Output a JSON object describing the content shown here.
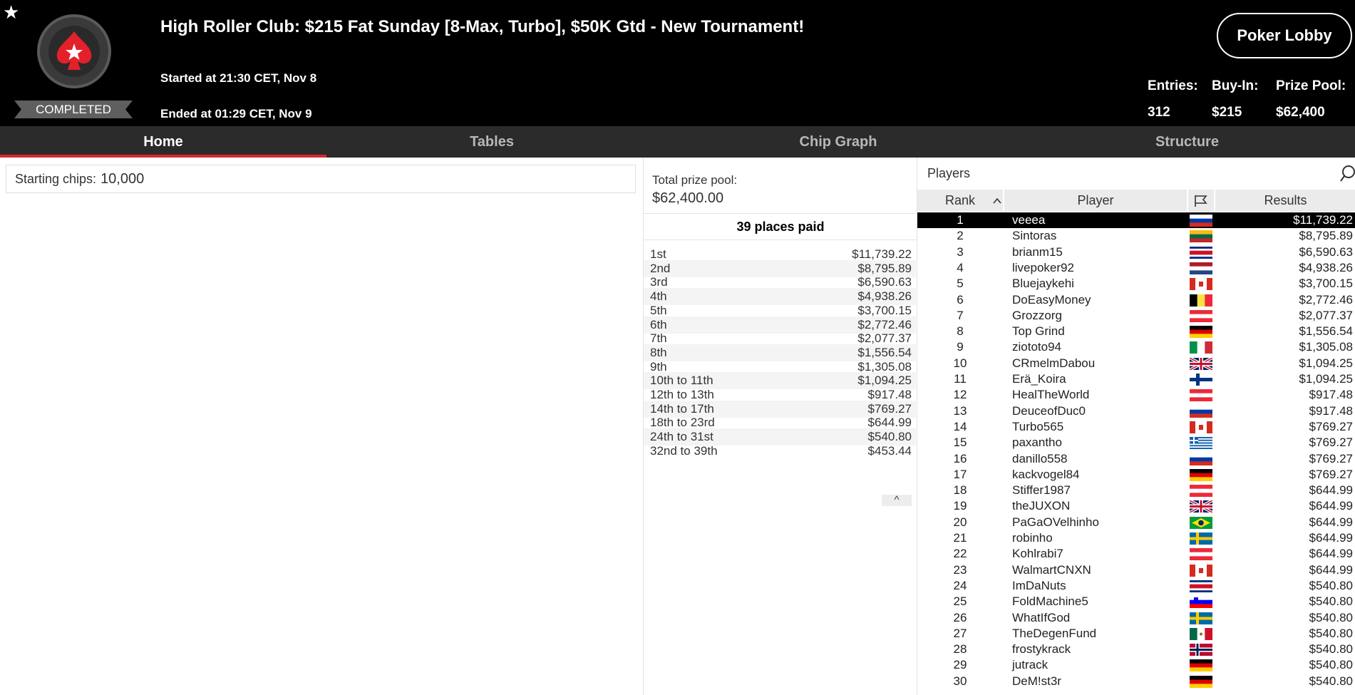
{
  "header": {
    "title": "High Roller Club: $215 Fat Sunday [8-Max, Turbo], $50K Gtd - New Tournament!",
    "started": "Started at 21:30 CET, Nov 8",
    "ended": "Ended at 01:29 CET, Nov 9",
    "status": "COMPLETED",
    "favorite_icon": "star-icon",
    "logo_icon": "spade-star-logo",
    "lobby_button": "Poker Lobby",
    "entries_label": "Entries:",
    "entries_value": "312",
    "buyin_label": "Buy-In:",
    "buyin_value": "$215",
    "prizepool_label": "Prize Pool:",
    "prizepool_value": "$62,400"
  },
  "tabs": [
    {
      "label": "Home",
      "active": true
    },
    {
      "label": "Tables",
      "active": false
    },
    {
      "label": "Chip Graph",
      "active": false
    },
    {
      "label": "Structure",
      "active": false
    }
  ],
  "home": {
    "starting_chips_label": "Starting chips:",
    "starting_chips_value": "10,000"
  },
  "prizes": {
    "total_label": "Total prize pool:",
    "total_value": "$62,400.00",
    "places_paid": "39 places paid",
    "collapse_icon": "chevron-up-icon",
    "payouts": [
      {
        "place": "1st",
        "amount": "$11,739.22"
      },
      {
        "place": "2nd",
        "amount": "$8,795.89"
      },
      {
        "place": "3rd",
        "amount": "$6,590.63"
      },
      {
        "place": "4th",
        "amount": "$4,938.26"
      },
      {
        "place": "5th",
        "amount": "$3,700.15"
      },
      {
        "place": "6th",
        "amount": "$2,772.46"
      },
      {
        "place": "7th",
        "amount": "$2,077.37"
      },
      {
        "place": "8th",
        "amount": "$1,556.54"
      },
      {
        "place": "9th",
        "amount": "$1,305.08"
      },
      {
        "place": "10th to 11th",
        "amount": "$1,094.25"
      },
      {
        "place": "12th to 13th",
        "amount": "$917.48"
      },
      {
        "place": "14th to 17th",
        "amount": "$769.27"
      },
      {
        "place": "18th to 23rd",
        "amount": "$644.99"
      },
      {
        "place": "24th to 31st",
        "amount": "$540.80"
      },
      {
        "place": "32nd to 39th",
        "amount": "$453.44"
      }
    ]
  },
  "players": {
    "title": "Players",
    "search_icon": "search-icon",
    "col_rank": "Rank",
    "sort_icon": "chevron-up-icon",
    "col_player": "Player",
    "col_flag_icon": "flag-icon",
    "col_results": "Results",
    "rows": [
      {
        "rank": "1",
        "name": "veeea",
        "flag": "russia",
        "result": "$11,739.22",
        "highlight": true
      },
      {
        "rank": "2",
        "name": "Sintoras",
        "flag": "lithuania",
        "result": "$8,795.89"
      },
      {
        "rank": "3",
        "name": "brianm15",
        "flag": "costa-rica",
        "result": "$6,590.63"
      },
      {
        "rank": "4",
        "name": "livepoker92",
        "flag": "netherlands",
        "result": "$4,938.26"
      },
      {
        "rank": "5",
        "name": "Bluejaykehi",
        "flag": "canada",
        "result": "$3,700.15"
      },
      {
        "rank": "6",
        "name": "DoEasyMoney",
        "flag": "belgium",
        "result": "$2,772.46"
      },
      {
        "rank": "7",
        "name": "Grozzorg",
        "flag": "austria",
        "result": "$2,077.37"
      },
      {
        "rank": "8",
        "name": "Top Grind",
        "flag": "germany",
        "result": "$1,556.54"
      },
      {
        "rank": "9",
        "name": "ziototo94",
        "flag": "italy",
        "result": "$1,305.08"
      },
      {
        "rank": "10",
        "name": "CRmelmDabou",
        "flag": "united-kingdom",
        "result": "$1,094.25"
      },
      {
        "rank": "11",
        "name": "Erä_Koira",
        "flag": "finland",
        "result": "$1,094.25"
      },
      {
        "rank": "12",
        "name": "HealTheWorld",
        "flag": "austria",
        "result": "$917.48"
      },
      {
        "rank": "13",
        "name": "DeuceofDuc0",
        "flag": "russia",
        "result": "$917.48"
      },
      {
        "rank": "14",
        "name": "Turbo565",
        "flag": "canada",
        "result": "$769.27"
      },
      {
        "rank": "15",
        "name": "paxantho",
        "flag": "greece",
        "result": "$769.27"
      },
      {
        "rank": "16",
        "name": "danillo558",
        "flag": "russia",
        "result": "$769.27"
      },
      {
        "rank": "17",
        "name": "kackvogel84",
        "flag": "germany",
        "result": "$769.27"
      },
      {
        "rank": "18",
        "name": "Stiffer1987",
        "flag": "austria",
        "result": "$644.99"
      },
      {
        "rank": "19",
        "name": "theJUXON",
        "flag": "united-kingdom",
        "result": "$644.99"
      },
      {
        "rank": "20",
        "name": "PaGaOVelhinho",
        "flag": "brazil",
        "result": "$644.99"
      },
      {
        "rank": "21",
        "name": "robinho",
        "flag": "sweden",
        "result": "$644.99"
      },
      {
        "rank": "22",
        "name": "Kohlrabi7",
        "flag": "austria",
        "result": "$644.99"
      },
      {
        "rank": "23",
        "name": "WalmartCNXN",
        "flag": "canada",
        "result": "$644.99"
      },
      {
        "rank": "24",
        "name": "ImDaNuts",
        "flag": "costa-rica",
        "result": "$540.80"
      },
      {
        "rank": "25",
        "name": "FoldMachine5",
        "flag": "slovenia",
        "result": "$540.80"
      },
      {
        "rank": "26",
        "name": "WhatIfGod",
        "flag": "sweden",
        "result": "$540.80"
      },
      {
        "rank": "27",
        "name": "TheDegenFund",
        "flag": "mexico",
        "result": "$540.80"
      },
      {
        "rank": "28",
        "name": "frostykrack",
        "flag": "norway",
        "result": "$540.80"
      },
      {
        "rank": "29",
        "name": "jutrack",
        "flag": "germany",
        "result": "$540.80"
      },
      {
        "rank": "30",
        "name": "DeM!st3r",
        "flag": "germany",
        "result": "$540.80"
      }
    ]
  }
}
